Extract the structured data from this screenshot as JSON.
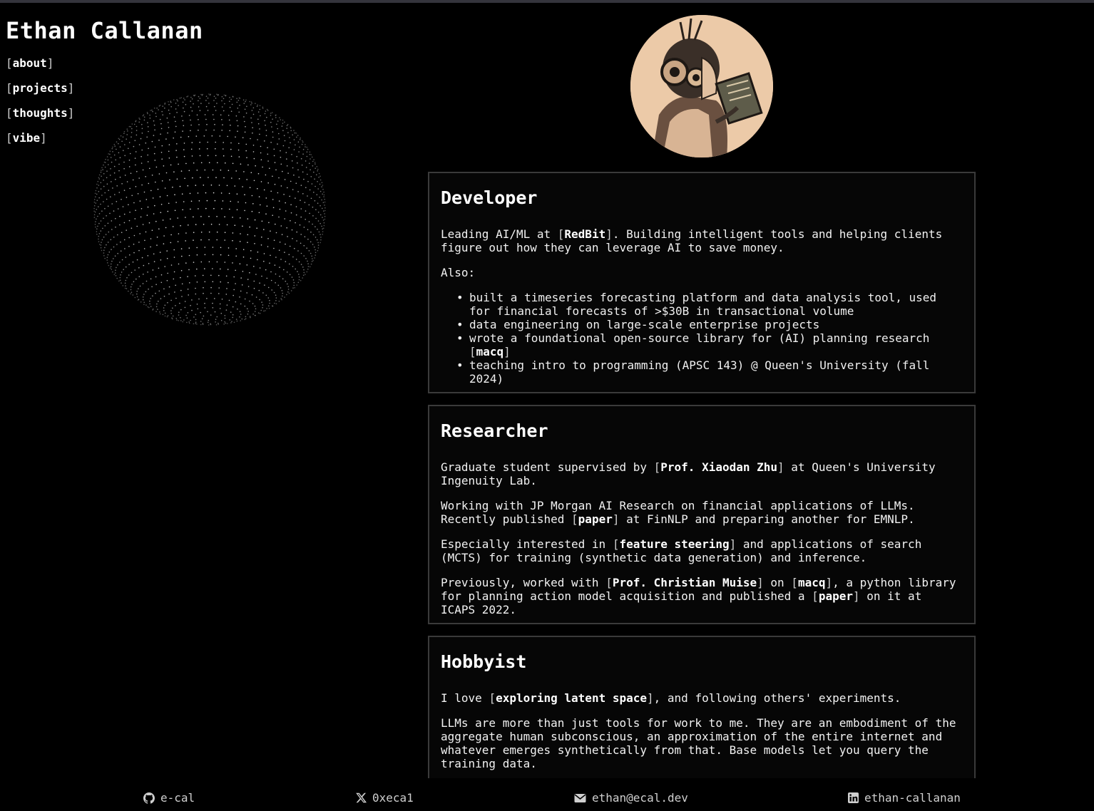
{
  "site": {
    "title": "Ethan Callanan"
  },
  "nav": {
    "items": [
      {
        "label": "about"
      },
      {
        "label": "projects"
      },
      {
        "label": "thoughts"
      },
      {
        "label": "vibe"
      }
    ]
  },
  "developer": {
    "heading": "Developer",
    "p1": {
      "a": "Leading AI/ML at ",
      "link": "RedBit",
      "b": ". Building intelligent tools and helping clients figure out how they can leverage AI to save money."
    },
    "also": "Also:",
    "bullets": {
      "b1": "built a timeseries forecasting platform and data analysis tool, used for financial forecasts of >$30B in transactional volume",
      "b2": "data engineering on large-scale enterprise projects",
      "b3": {
        "text": "wrote a foundational open-source library for (AI) planning research ",
        "link": "macq"
      },
      "b4": "teaching intro to programming (APSC 143) @ Queen's University (fall 2024)"
    }
  },
  "researcher": {
    "heading": "Researcher",
    "p1": {
      "a": "Graduate student supervised by ",
      "link": "Prof. Xiaodan Zhu",
      "b": " at Queen's University Ingenuity Lab."
    },
    "p2": {
      "a": "Working with JP Morgan AI Research on financial applications of LLMs. Recently published ",
      "link": "paper",
      "b": " at FinNLP and preparing another for EMNLP."
    },
    "p3": {
      "a": "Especially interested in ",
      "link": "feature steering",
      "b": " and applications of search (MCTS) for training (synthetic data generation) and inference."
    },
    "p4": {
      "a": "Previously, worked with ",
      "link1": "Prof. Christian Muise",
      "b": " on ",
      "link2": "macq",
      "c": ", a python library for planning action model acquisition and published a ",
      "link3": "paper",
      "d": " on it at ICAPS 2022."
    }
  },
  "hobbyist": {
    "heading": "Hobbyist",
    "p1": {
      "a": "I love ",
      "link": "exploring latent space",
      "b": ", and following others' experiments."
    },
    "p2": "LLMs are more than just tools for work to me. They are an embodiment of the aggregate human subconscious, an approximation of the entire internet and whatever emerges synthetically from that. Base models let you query the training data."
  },
  "footer": {
    "github": {
      "icon": "github-icon",
      "label": "e-cal"
    },
    "x": {
      "icon": "x-icon",
      "label": "0xeca1"
    },
    "email": {
      "icon": "envelope-icon",
      "label": "ethan@ecal.dev"
    },
    "linkedin": {
      "icon": "linkedin-icon",
      "label": "ethan-callanan"
    }
  },
  "colors": {
    "background": "#000000",
    "card_border": "#3a3a3a",
    "avatar_tone": "#e8c6a4"
  }
}
